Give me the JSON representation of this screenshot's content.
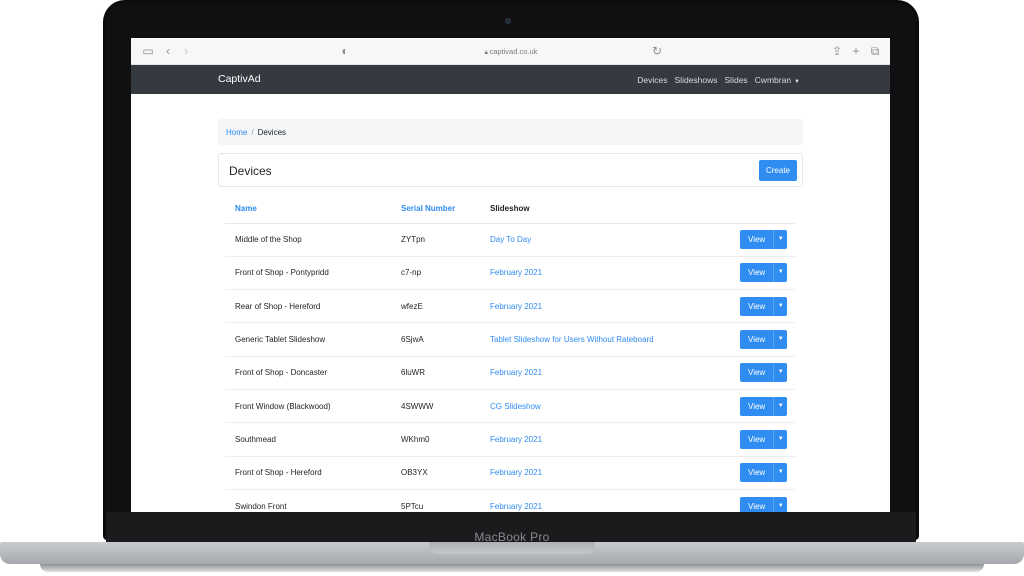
{
  "browser": {
    "url": "captivad.co.uk"
  },
  "laptop": {
    "model_label": "MacBook Pro"
  },
  "navbar": {
    "brand": "CaptivAd",
    "links": [
      "Devices",
      "Slideshows",
      "Slides",
      "Cwmbran"
    ]
  },
  "breadcrumb": {
    "home": "Home",
    "current": "Devices"
  },
  "page": {
    "title": "Devices",
    "create_label": "Create"
  },
  "table": {
    "headers": [
      "Name",
      "Serial Number",
      "Slideshow"
    ],
    "view_label": "View",
    "rows": [
      {
        "name": "Middle of the Shop",
        "serial": "ZYTpn",
        "slideshow": "Day To Day"
      },
      {
        "name": "Front of Shop - Pontypridd",
        "serial": "c7-np",
        "slideshow": "February 2021"
      },
      {
        "name": "Rear of Shop - Hereford",
        "serial": "wfezE",
        "slideshow": "February 2021"
      },
      {
        "name": "Generic Tablet Slideshow",
        "serial": "6SjwA",
        "slideshow": "Tablet Slideshow for Users Without Rateboard"
      },
      {
        "name": "Front of Shop - Doncaster",
        "serial": "6luWR",
        "slideshow": "February 2021"
      },
      {
        "name": "Front Window (Blackwood)",
        "serial": "4SWWW",
        "slideshow": "CG Slideshow"
      },
      {
        "name": "Southmead",
        "serial": "WKhm0",
        "slideshow": "February 2021"
      },
      {
        "name": "Front of Shop - Hereford",
        "serial": "OB3YX",
        "slideshow": "February 2021"
      },
      {
        "name": "Swindon Front",
        "serial": "5PTcu",
        "slideshow": "February 2021"
      }
    ]
  },
  "colors": {
    "accent": "#2f8cf0",
    "navbar": "#343a40"
  }
}
